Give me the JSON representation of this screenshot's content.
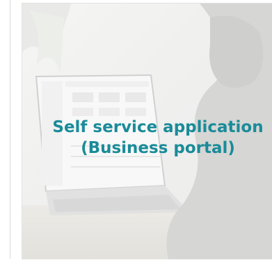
{
  "card": {
    "title_line1": "Self service application",
    "title_line2": "(Business portal)",
    "image_icon": "laptop-photo",
    "accent_color": "#1a8b99"
  }
}
